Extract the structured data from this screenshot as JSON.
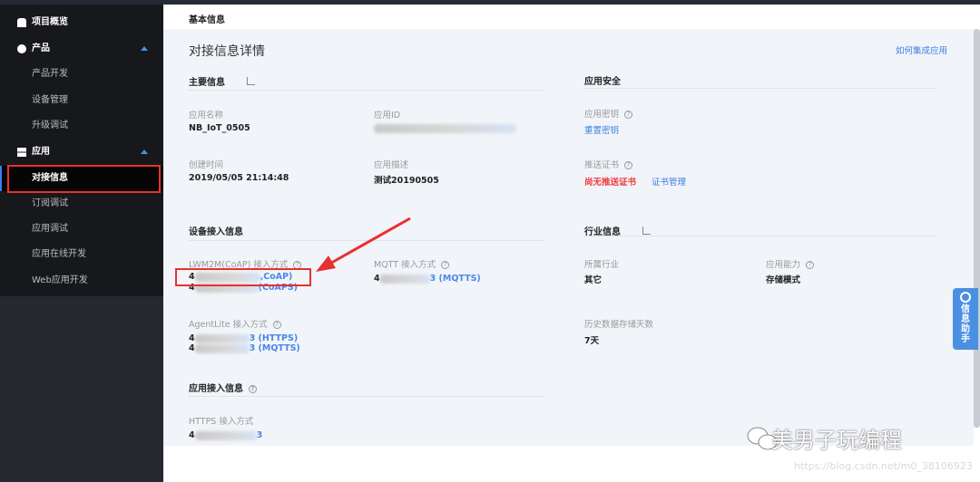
{
  "sidebar": {
    "items": [
      {
        "label": "项目概览"
      },
      {
        "label": "产品"
      },
      {
        "label": "产品开发"
      },
      {
        "label": "设备管理"
      },
      {
        "label": "升级调试"
      },
      {
        "label": "应用"
      },
      {
        "label": "对接信息"
      },
      {
        "label": "订阅调试"
      },
      {
        "label": "应用调试"
      },
      {
        "label": "应用在线开发"
      },
      {
        "label": "Web应用开发"
      }
    ]
  },
  "header": {
    "tab": "基本信息"
  },
  "page": {
    "title": "对接信息详情",
    "help_link": "如何集成应用"
  },
  "main_info": {
    "title": "主要信息",
    "app_name_label": "应用名称",
    "app_name": "NB_IoT_0505",
    "app_id_label": "应用ID",
    "created_label": "创建时间",
    "created": "2019/05/05 21:14:48",
    "desc_label": "应用描述",
    "desc": "测试20190505"
  },
  "security": {
    "title": "应用安全",
    "key_label": "应用密钥",
    "reset_key": "重置密钥",
    "cert_label": "推送证书",
    "no_cert": "尚无推送证书",
    "cert_manage": "证书管理"
  },
  "device_access": {
    "title": "设备接入信息",
    "lwm2m_label": "LWM2M(CoAP) 接入方式",
    "lwm2m": [
      {
        "prefix": "4",
        "suffix": ",CoAP)"
      },
      {
        "prefix": "4",
        "suffix": "(CoAPS)"
      }
    ],
    "mqtt_label": "MQTT 接入方式",
    "mqtt": {
      "prefix": "4",
      "suffix": "3 (MQTTS)"
    },
    "agentlite_label": "AgentLite 接入方式",
    "agentlite": [
      {
        "prefix": "4",
        "suffix": "3 (HTTPS)"
      },
      {
        "prefix": "4",
        "suffix": "3 (MQTTS)"
      }
    ]
  },
  "industry": {
    "title": "行业信息",
    "industry_label": "所属行业",
    "industry": "其它",
    "capability_label": "应用能力",
    "capability": "存储模式",
    "history_label": "历史数据存储天数",
    "history": "7天"
  },
  "app_access": {
    "title": "应用接入信息",
    "https_label": "HTTPS 接入方式",
    "https": {
      "prefix": "4",
      "suffix": "3"
    }
  },
  "helper": {
    "label": "信息助手"
  },
  "watermark": {
    "text": "美男子玩编程",
    "url": "https://blog.csdn.net/m0_38106923"
  },
  "colors": {
    "accent": "#3d7fe0",
    "annotation": "#e8312f"
  }
}
